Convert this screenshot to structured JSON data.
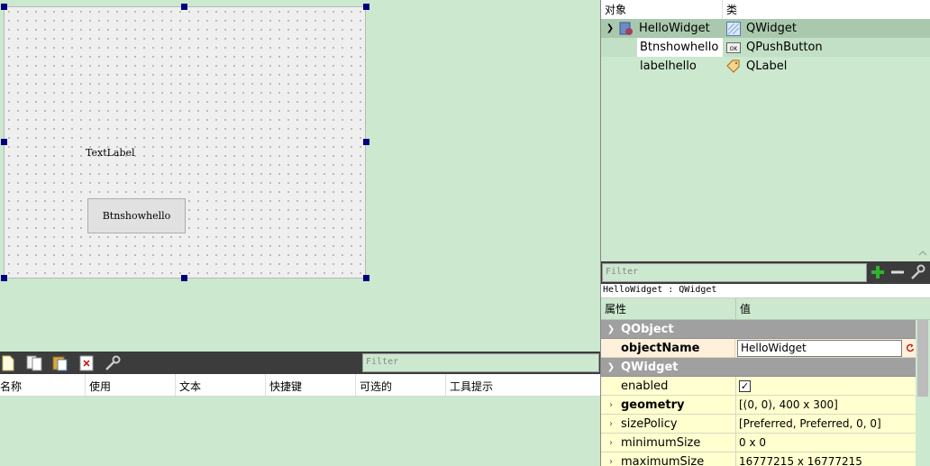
{
  "form": {
    "label_text": "TextLabel",
    "button_text": "Btnshowhello"
  },
  "action_editor": {
    "filter_placeholder": "Filter",
    "columns": [
      "名称",
      "使用",
      "文本",
      "快捷键",
      "可选的",
      "工具提示"
    ]
  },
  "object_inspector": {
    "header_object": "对象",
    "header_class": "类",
    "rows": [
      {
        "name": "HelloWidget",
        "class": "QWidget",
        "icon": "widget-icon"
      },
      {
        "name": "Btnshowhello",
        "class": "QPushButton",
        "icon": "pushbutton-icon"
      },
      {
        "name": "labelhello",
        "class": "QLabel",
        "icon": "label-icon"
      }
    ]
  },
  "property_editor": {
    "filter_placeholder": "Filter",
    "caption": "HelloWidget : QWidget",
    "header_property": "属性",
    "header_value": "值",
    "groups": [
      "QObject",
      "QWidget"
    ],
    "object_name_key": "objectName",
    "object_name_value": "HelloWidget",
    "enabled_key": "enabled",
    "enabled_checked": true,
    "properties": [
      {
        "key": "geometry",
        "value": "[(0, 0), 400 x 300]"
      },
      {
        "key": "sizePolicy",
        "value": "[Preferred, Preferred, 0, 0]"
      },
      {
        "key": "minimumSize",
        "value": "0 x 0"
      },
      {
        "key": "maximumSize",
        "value": "16777215 x 16777215"
      }
    ]
  },
  "colors": {
    "background": "#cce8cf",
    "selection_handle": "#000080",
    "toolbar_dark": "#3c3c3c",
    "group_header": "#a0a0a0"
  }
}
